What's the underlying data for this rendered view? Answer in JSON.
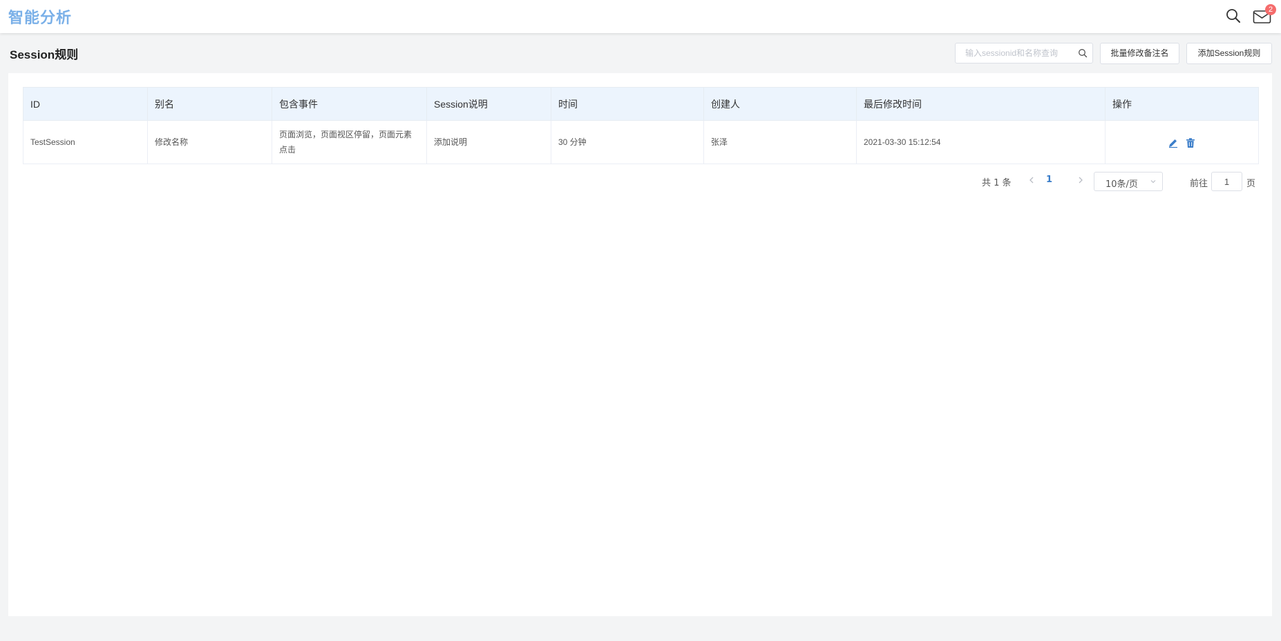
{
  "header": {
    "brand": "智能分析",
    "search_icon": "search-icon",
    "mail_icon": "mail-icon",
    "mail_badge": "2"
  },
  "page": {
    "title": "Session规则",
    "search_placeholder": "输入sessionid和名称查询",
    "batch_button": "批量修改备注名",
    "add_button": "添加Session规则"
  },
  "table": {
    "columns": [
      "ID",
      "别名",
      "包含事件",
      "Session说明",
      "时间",
      "创建人",
      "最后修改时间",
      "操作"
    ],
    "rows": [
      {
        "id": "TestSession",
        "alias": "修改名称",
        "events": "页面浏览，页面视区停留，页面元素点击",
        "description": "添加说明",
        "duration": "30 分钟",
        "creator": "张泽",
        "modified": "2021-03-30 15:12:54",
        "edit_icon": "edit-icon",
        "delete_icon": "trash-icon"
      }
    ]
  },
  "pagination": {
    "total": "共 1 条",
    "current_page": "1",
    "page_size": "10条/页",
    "goto_label": "前往",
    "goto_value": "1",
    "page_suffix": "页"
  },
  "colors": {
    "brand": "#7ab0e8",
    "link": "#3a7dc9",
    "badge": "#f56c6c",
    "table_header_bg": "#ecf4fd"
  }
}
